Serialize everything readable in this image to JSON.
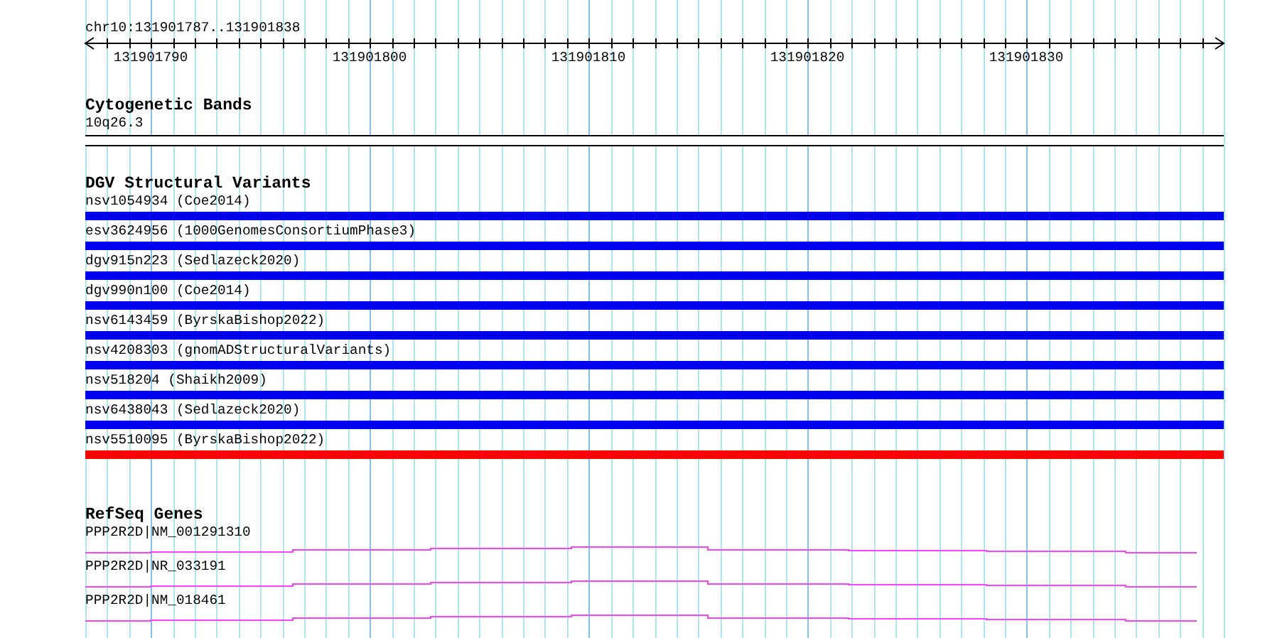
{
  "ruler": {
    "region": "chr10:131901787..131901838",
    "tick_labels": [
      "131901790",
      "131901800",
      "131901810",
      "131901820",
      "131901830"
    ]
  },
  "cytogenetic_bands": {
    "title": "Cytogenetic Bands",
    "band": "10q26.3"
  },
  "dgv_structural_variants": {
    "title": "DGV Structural Variants",
    "features": [
      {
        "label": "nsv1054934 (Coe2014)",
        "color": "#0000ee"
      },
      {
        "label": "esv3624956 (1000GenomesConsortiumPhase3)",
        "color": "#0000ee"
      },
      {
        "label": "dgv915n223 (Sedlazeck2020)",
        "color": "#0000ee"
      },
      {
        "label": "dgv990n100 (Coe2014)",
        "color": "#0000ee"
      },
      {
        "label": "nsv6143459 (ByrskaBishop2022)",
        "color": "#0000ee"
      },
      {
        "label": "nsv4208303 (gnomADStructuralVariants)",
        "color": "#0000ee"
      },
      {
        "label": "nsv518204 (Shaikh2009)",
        "color": "#0000ee"
      },
      {
        "label": "nsv6438043 (Sedlazeck2020)",
        "color": "#0000ee"
      },
      {
        "label": "nsv5510095 (ByrskaBishop2022)",
        "color": "#ff0000"
      }
    ]
  },
  "refseq_genes": {
    "title": "RefSeq Genes",
    "features": [
      {
        "label": "PPP2R2D|NM_001291310"
      },
      {
        "label": "PPP2R2D|NR_033191"
      },
      {
        "label": "PPP2R2D|NM_018461"
      }
    ]
  }
}
